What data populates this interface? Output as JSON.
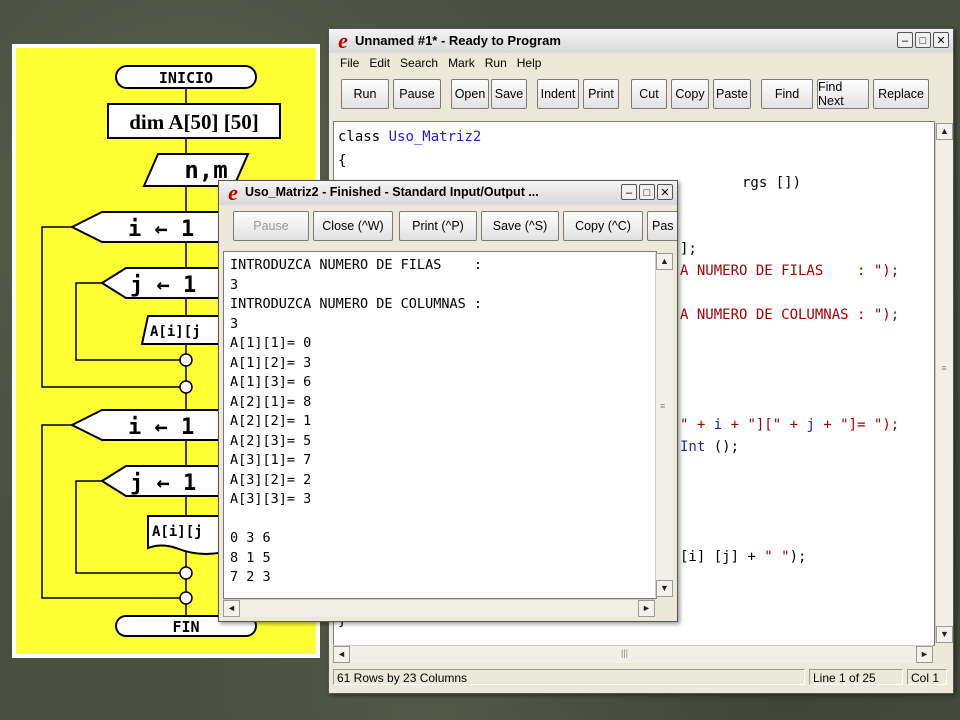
{
  "flowchart": {
    "start": "INICIO",
    "dim": "dim A[50] [50]",
    "input": "n,m",
    "loop_i_1": "i ← 1",
    "loop_j_1": "j ← 1",
    "read_cell": "A[i][j",
    "loop_i_2": "i ← 1",
    "loop_j_2": "j ← 1",
    "print_cell": "A[i][j",
    "end": "FIN"
  },
  "editor_window": {
    "title": "Unnamed #1* - Ready to Program",
    "menu": [
      "File",
      "Edit",
      "Search",
      "Mark",
      "Run",
      "Help"
    ],
    "toolbar": [
      "Run",
      "Pause",
      "Open",
      "Save",
      "Indent",
      "Print",
      "Cut",
      "Copy",
      "Paste",
      "Find",
      "Find Next",
      "Replace"
    ],
    "code": {
      "l1_kw": "class",
      "l1_name": "Uso_Matriz2",
      "l2": "{",
      "l3": "rgs [])",
      "l4": "];",
      "l5": "A NUMERO DE FILAS    : \");",
      "l6": "A NUMERO DE COLUMNAS : \");",
      "l7a": "\" + ",
      "l7b": "i",
      "l7c": " + \"][\" + ",
      "l7d": "j",
      "l7e": " + \"]= \");",
      "l8a": "Int",
      "l8b": " ();",
      "l9a": "[i] [j] + ",
      "l9b": "\" \"",
      "l9c": ");",
      "l10": "}"
    },
    "status_left": "61 Rows by 23 Columns",
    "status_line": "Line 1 of 25",
    "status_col": "Col 1"
  },
  "output_window": {
    "title": "Uso_Matriz2 - Finished  - Standard Input/Output ...",
    "toolbar": [
      "Pause",
      "Close (^W)",
      "Print (^P)",
      "Save (^S)",
      "Copy (^C)",
      "Pas"
    ],
    "lines": [
      "INTRODUZCA NUMERO DE FILAS    :",
      "3",
      "INTRODUZCA NUMERO DE COLUMNAS :",
      "3",
      "A[1][1]= 0",
      "A[1][2]= 3",
      "A[1][3]= 6",
      "A[2][1]= 8",
      "A[2][2]= 1",
      "A[2][3]= 5",
      "A[3][1]= 7",
      "A[3][2]= 2",
      "A[3][3]= 3",
      "",
      "0 3 6",
      "8 1 5",
      "7 2 3"
    ]
  }
}
